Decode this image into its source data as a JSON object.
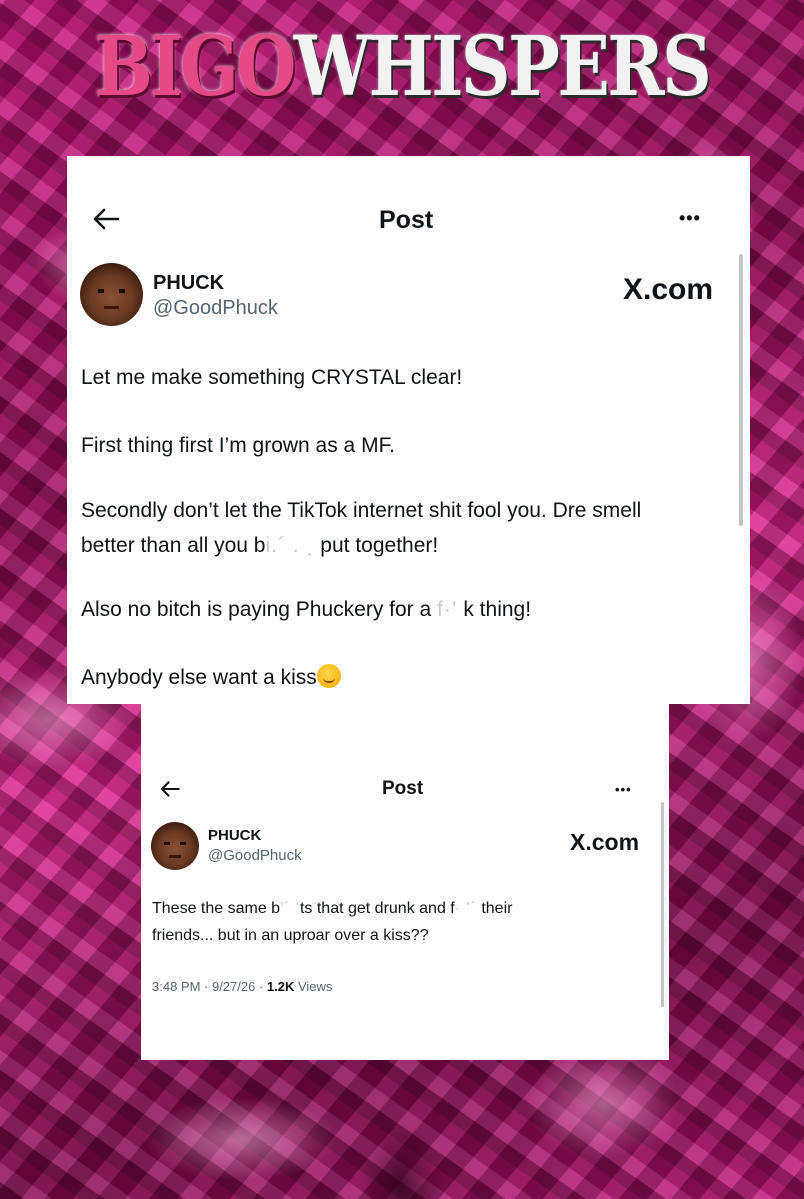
{
  "brand": {
    "part1": "BIGO",
    "part2": "WHISPERS",
    "accent": "#e34a86",
    "background": "#b41a73"
  },
  "post1": {
    "header_title": "Post",
    "back_icon": "back-arrow-icon",
    "more_icon": "more-icon",
    "more": "•••",
    "author_name": "PHUCK",
    "author_handle": "@GoodPhuck",
    "site": "X.com",
    "lines": {
      "l1": "Let me make something CRYSTAL clear!",
      "l2": "First thing first I’m grown as a MF.",
      "l3": "Secondly don’t let the TikTok internet shit fool you. Dre smell",
      "l4a": "better than all you b",
      "l4b": "i.´ . ˎ",
      "l4c": " put together!",
      "l5a": "Also no bitch is paying Phuckery for a ",
      "l5b": "f·’",
      "l5c": " k thing!",
      "l6": "Anybody else want  a kiss"
    }
  },
  "post2": {
    "header_title": "Post",
    "more": "•••",
    "author_name": "PHUCK",
    "author_handle": "@GoodPhuck",
    "site": "X.com",
    "line1a": "These the same b",
    "line1b": "'´ ' ",
    "line1c": "ts that get drunk and f",
    "line1d": "· '´",
    "line1e": " their",
    "line2": "friends... but in an uproar over a kiss??",
    "time": "3:48 PM · 9/27/26 · ",
    "views_count": "1.2K",
    "views_label": " Views"
  }
}
